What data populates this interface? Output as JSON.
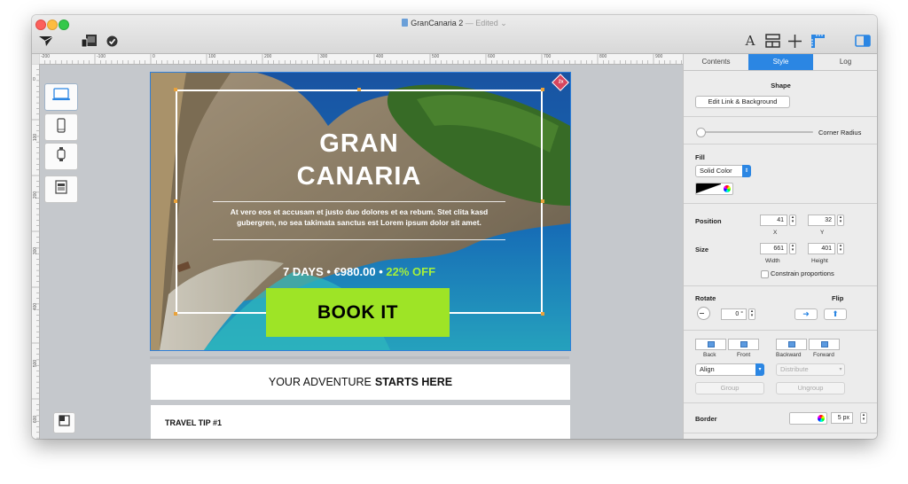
{
  "window": {
    "title": "GranCanaria 2",
    "edited": "— Edited ⌄"
  },
  "toolbar": {
    "send_icon": "paper-plane-icon",
    "devices_icon": "devices-icon",
    "check_icon": "checkmark-circle-icon",
    "text_tool": "A",
    "layout_icon": "layout-icon",
    "move_icon": "move-icon",
    "ruler_icon": "ruler-icon",
    "sidebar_icon": "sidebar-icon"
  },
  "ruler": {
    "h_ticks": [
      "-200",
      "-100",
      "0",
      "100",
      "200",
      "300",
      "400",
      "500",
      "600",
      "700",
      "800",
      "900"
    ],
    "v_ticks": [
      "0",
      "100",
      "200",
      "300",
      "400",
      "500",
      "600"
    ]
  },
  "hero": {
    "badge": "2x",
    "title_line1": "GRAN",
    "title_line2": "CANARIA",
    "body": "At vero eos et accusam et justo duo dolores et ea rebum. Stet clita kasd gubergren, no sea takimata sanctus est Lorem ipsum dolor sit amet.",
    "days": "7 DAYS",
    "dot": "•",
    "price": "€980.00",
    "discount": "22% OFF",
    "cta": "BOOK IT"
  },
  "tagline": {
    "normal": "YOUR ADVENTURE",
    "bold": "STARTS HERE"
  },
  "tip": {
    "title": "TRAVEL TIP #1"
  },
  "inspector": {
    "tabs": [
      "Contents",
      "Style",
      "Log"
    ],
    "active_tab": "Style",
    "shape_heading": "Shape",
    "edit_link_btn": "Edit Link & Background",
    "corner_radius_label": "Corner Radius",
    "fill_label": "Fill",
    "fill_type": "Solid Color",
    "position_label": "Position",
    "pos_x": "41",
    "pos_y": "32",
    "x_label": "X",
    "y_label": "Y",
    "size_label": "Size",
    "width": "661",
    "height": "401",
    "width_label": "Width",
    "height_label": "Height",
    "constrain_label": "Constrain proportions",
    "rotate_label": "Rotate",
    "rotate_value": "0 °",
    "flip_label": "Flip",
    "back_label": "Back",
    "front_label": "Front",
    "backward_label": "Backward",
    "forward_label": "Forward",
    "align_label": "Align",
    "distribute_label": "Distribute",
    "group_label": "Group",
    "ungroup_label": "Ungroup",
    "border_label": "Border",
    "border_size": "5 px"
  },
  "colors": {
    "accent": "#2b86e3",
    "cta": "#9ee426",
    "discount": "#a6f03a"
  }
}
